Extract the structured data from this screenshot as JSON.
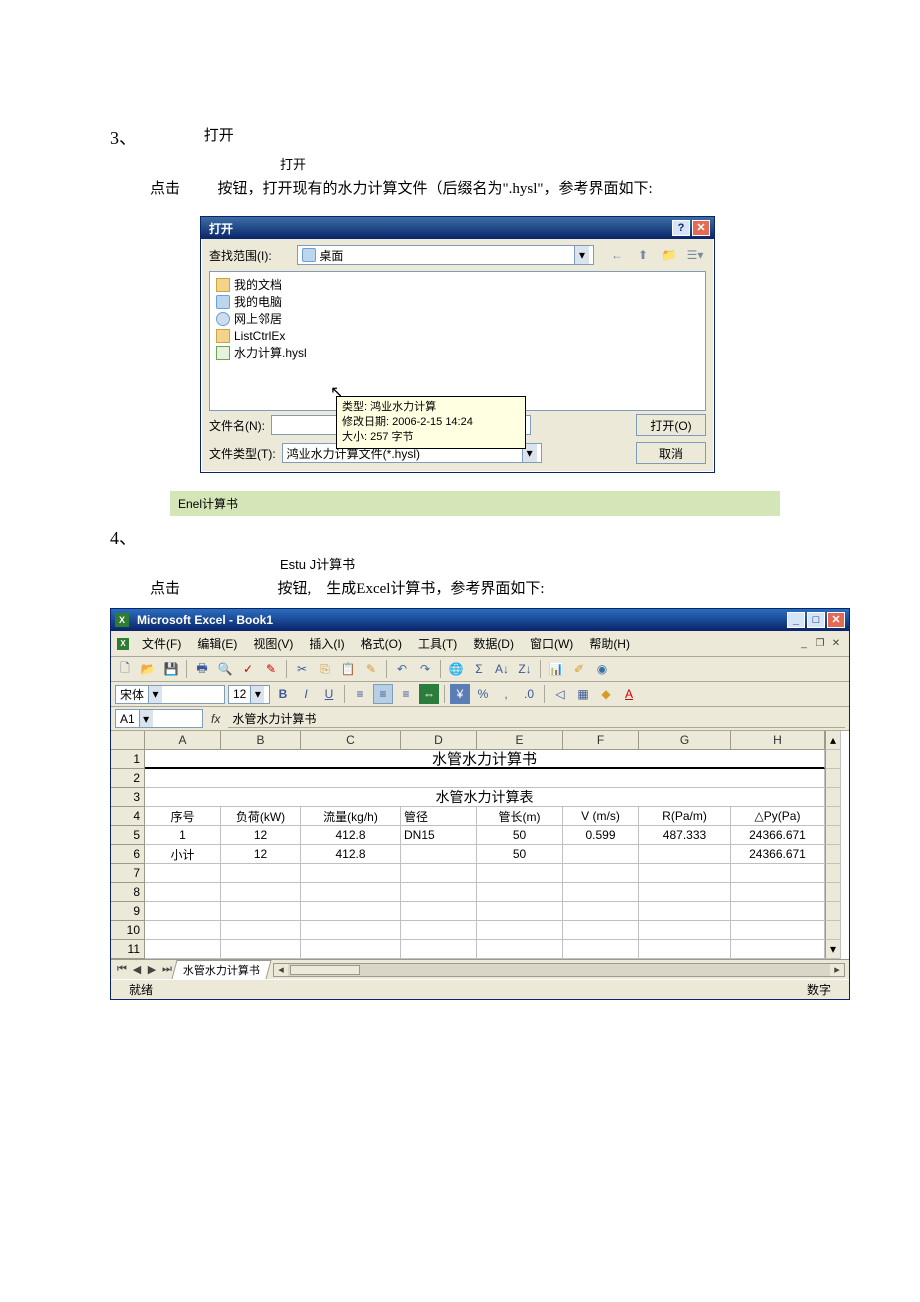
{
  "section3": {
    "num": "3、",
    "title": "打开",
    "btn": "打开",
    "paraA": "点击",
    "paraB": "按钮，打开现有的水力计算文件（后缀名为\".hysl\"，参考界面如下:"
  },
  "opendlg": {
    "caption": "打开",
    "lookInLabel": "查找范围(I):",
    "lookInValue": "桌面",
    "items": [
      "我的文档",
      "我的电脑",
      "网上邻居",
      "ListCtrlEx",
      "水力计算.hysl"
    ],
    "tooltip": {
      "l1": "类型: 鸿业水力计算",
      "l2": "修改日期: 2006-2-15 14:24",
      "l3": "大小: 257 字节"
    },
    "fileLabel": "文件名(N):",
    "fileValue": "",
    "typeLabel": "文件类型(T):",
    "typeValue": "鸿业水力计算文件(*.hysl)",
    "openBtn": "打开(O)",
    "cancelBtn": "取消"
  },
  "greenbar": "Enel计算书",
  "section4": {
    "num": "4、",
    "btn": "Estu J计算书",
    "paraA": "点击",
    "paraB": "按钮,",
    "paraC": "生成Excel计算书，参考界面如下:"
  },
  "excel": {
    "title": "Microsoft Excel - Book1",
    "menus": [
      "文件(F)",
      "编辑(E)",
      "视图(V)",
      "插入(I)",
      "格式(O)",
      "工具(T)",
      "数据(D)",
      "窗口(W)",
      "帮助(H)"
    ],
    "fontName": "宋体",
    "fontSize": "12",
    "nameBox": "A1",
    "formula": "水管水力计算书",
    "colHeaders": [
      "A",
      "B",
      "C",
      "D",
      "E",
      "F",
      "G",
      "H"
    ],
    "rowHeaders": [
      "1",
      "2",
      "3",
      "4",
      "5",
      "6",
      "7",
      "8",
      "9",
      "10",
      "11"
    ],
    "r1_title": "水管水力计算书",
    "r3_title": "水管水力计算表",
    "r4": [
      "序号",
      "负荷(kW)",
      "流量(kg/h)",
      "管径",
      "管长(m)",
      "V (m/s)",
      "R(Pa/m)",
      "△Py(Pa)"
    ],
    "r5": [
      "1",
      "12",
      "412.8",
      "DN15",
      "50",
      "0.599",
      "487.333",
      "24366.671"
    ],
    "r6": [
      "小计",
      "12",
      "412.8",
      "",
      "50",
      "",
      "",
      "24366.671"
    ],
    "sheetName": "水管水力计算书",
    "status": "就绪",
    "statusNum": "数字"
  },
  "chart_data": {
    "type": "table",
    "title": "水管水力计算表",
    "columns": [
      "序号",
      "负荷(kW)",
      "流量(kg/h)",
      "管径",
      "管长(m)",
      "V (m/s)",
      "R(Pa/m)",
      "△Py(Pa)"
    ],
    "rows": [
      [
        "1",
        12,
        412.8,
        "DN15",
        50,
        0.599,
        487.333,
        24366.671
      ],
      [
        "小计",
        12,
        412.8,
        "",
        50,
        "",
        "",
        24366.671
      ]
    ]
  }
}
